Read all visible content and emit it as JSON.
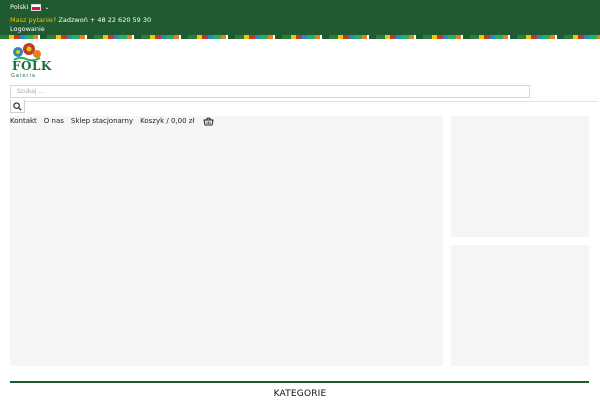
{
  "topbar": {
    "language": "Polski",
    "ask_link": "Masz pytanie?",
    "call_text": "Zadzwoń + 48 22 620 59 30",
    "login": "Logowanie"
  },
  "logo": {
    "title": "FOLK",
    "subtitle": "Galeria"
  },
  "search": {
    "placeholder": "Szukaj ..."
  },
  "nav": {
    "items": [
      "Kontakt",
      "O nas",
      "Sklep stacjonarny"
    ],
    "cart_label": "Koszyk / 0,00 zł"
  },
  "section": {
    "title": "KATEGORIE"
  },
  "colors": {
    "brand_green": "#1f5a30",
    "accent_yellow": "#f2c200"
  }
}
